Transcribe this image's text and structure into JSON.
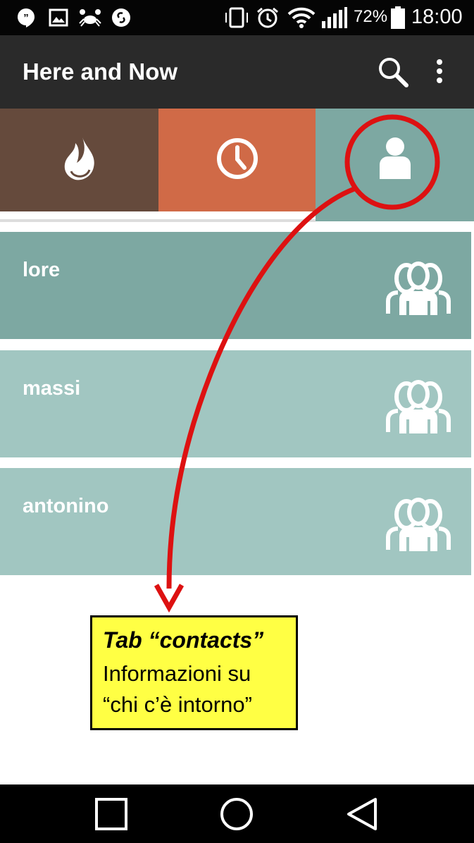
{
  "status_bar": {
    "icons": [
      "hangouts-icon",
      "gallery-icon",
      "crab-icon",
      "shazam-icon",
      "vibrate-icon",
      "alarm-icon",
      "wifi-icon",
      "signal-icon"
    ],
    "battery": "72%",
    "time": "18:00"
  },
  "app_bar": {
    "title": "Here and Now",
    "actions": [
      "search-icon",
      "more-vert-icon"
    ]
  },
  "tabs": [
    {
      "icon": "flame-icon",
      "color": "#654a3c"
    },
    {
      "icon": "clock-icon",
      "color": "#d06a47"
    },
    {
      "icon": "person-icon",
      "color": "#7da8a2",
      "selected": true
    }
  ],
  "contacts": [
    {
      "name": "lore",
      "icon": "group-icon",
      "color": "#7da8a2"
    },
    {
      "name": "massi",
      "icon": "group-icon",
      "color": "#a1c6c1"
    },
    {
      "name": "antonino",
      "icon": "group-icon",
      "color": "#a1c6c1"
    }
  ],
  "callout": {
    "title": "Tab “contacts”",
    "line1": "Informazioni su",
    "line2": "“chi c’è intorno”",
    "background": "#ffff44"
  },
  "annotation": {
    "color": "#dd1111"
  },
  "nav_bar": [
    "back-icon",
    "home-icon",
    "recents-icon"
  ]
}
